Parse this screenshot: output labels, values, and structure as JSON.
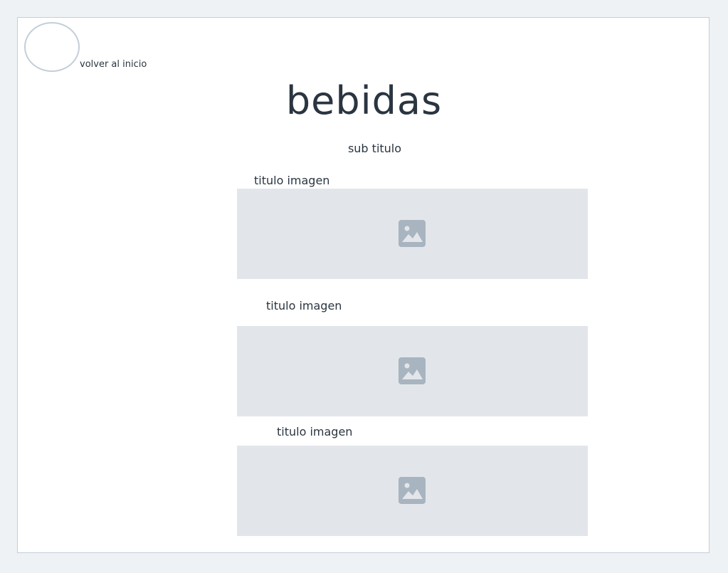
{
  "nav": {
    "home_label": "volver al inicio"
  },
  "header": {
    "title": "bebidas",
    "subtitle": "sub titulo"
  },
  "images": [
    {
      "title": "titulo imagen",
      "icon": "image-placeholder-icon"
    },
    {
      "title": "titulo imagen",
      "icon": "image-placeholder-icon"
    },
    {
      "title": "titulo imagen",
      "icon": "image-placeholder-icon"
    }
  ],
  "colors": {
    "background": "#eef2f5",
    "panel": "#ffffff",
    "border": "#c4ced8",
    "placeholder": "#e2e6ea",
    "icon": "#a8b4bf",
    "text": "#2a3540"
  }
}
